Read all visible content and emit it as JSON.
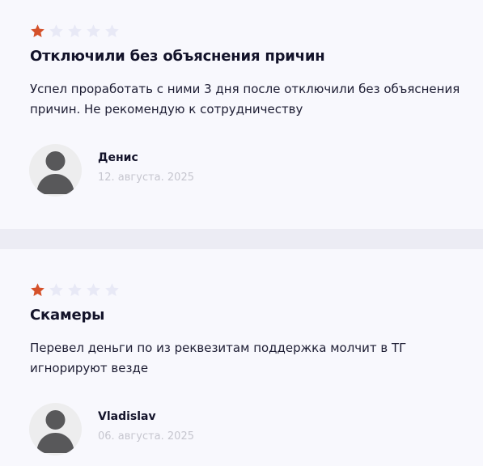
{
  "colors": {
    "star_filled": "#d5512a",
    "star_empty": "#e8e9f6",
    "background": "#f8f8fd",
    "divider": "#ececf4",
    "avatar_bg": "#ededee",
    "avatar_figure": "#58585a",
    "date_text": "#c6c6cf"
  },
  "reviews": [
    {
      "rating": 1,
      "max_rating": 5,
      "title": "Отключили без объяснения причин",
      "body": "Успел проработать с ними 3 дня после отключили без объяснения\nпричин. Не рекомендую к сотрудничеству",
      "author": "Денис",
      "date": "12. августа. 2025",
      "avatar_icon": "user-silhouette-icon"
    },
    {
      "rating": 1,
      "max_rating": 5,
      "title": "Скамеры",
      "body": "Перевел деньги по из реквезитам поддержка молчит в ТГ\nигнорируют везде",
      "author": "Vladislav",
      "date": "06. августа. 2025",
      "avatar_icon": "user-silhouette-icon"
    }
  ]
}
